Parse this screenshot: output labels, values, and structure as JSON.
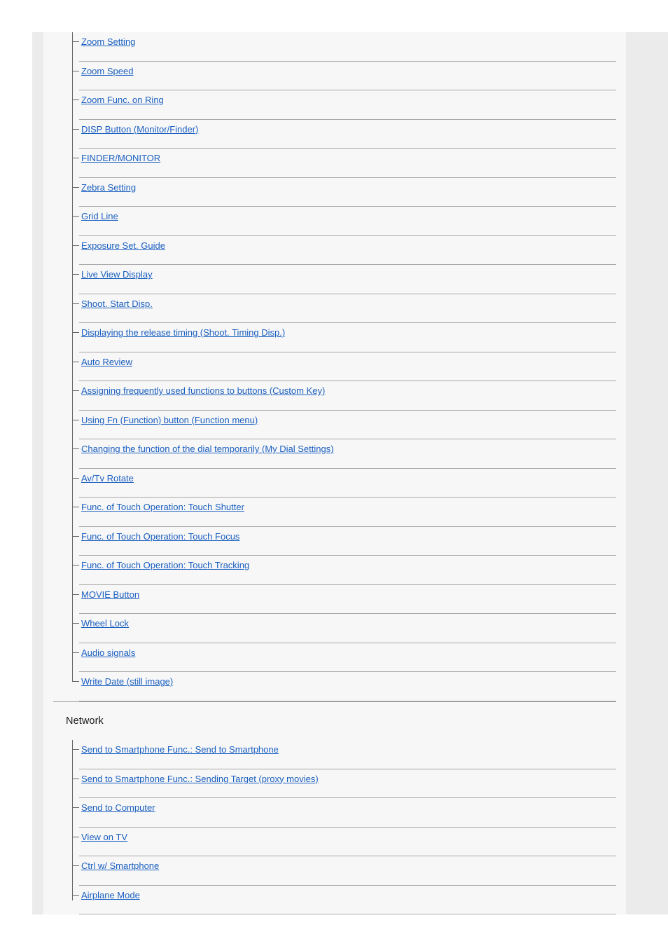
{
  "theme": {
    "page_background": "#ffffff",
    "gutter_background": "#ebebeb",
    "content_background": "#f7f7f7",
    "link_color": "#1a5fc0",
    "heading_color": "#1a1a1a",
    "tree_line_color": "#666666",
    "row_separator_color": "#a8a8a8",
    "section_divider_color": "#999999"
  },
  "sections": [
    {
      "title": null,
      "items": [
        {
          "label": "Zoom Setting"
        },
        {
          "label": "Zoom Speed"
        },
        {
          "label": "Zoom Func. on Ring"
        },
        {
          "label": "DISP Button (Monitor/Finder)"
        },
        {
          "label": "FINDER/MONITOR"
        },
        {
          "label": "Zebra Setting"
        },
        {
          "label": "Grid Line"
        },
        {
          "label": "Exposure Set. Guide"
        },
        {
          "label": "Live View Display"
        },
        {
          "label": "Shoot. Start Disp."
        },
        {
          "label": "Displaying the release timing (Shoot. Timing Disp.)"
        },
        {
          "label": "Auto Review"
        },
        {
          "label": "Assigning frequently used functions to buttons (Custom Key)"
        },
        {
          "label": "Using Fn (Function) button (Function menu)"
        },
        {
          "label": "Changing the function of the dial temporarily (My Dial Settings)"
        },
        {
          "label": "Av/Tv Rotate"
        },
        {
          "label": "Func. of Touch Operation: Touch Shutter"
        },
        {
          "label": "Func. of Touch Operation: Touch Focus"
        },
        {
          "label": "Func. of Touch Operation: Touch Tracking"
        },
        {
          "label": "MOVIE Button"
        },
        {
          "label": "Wheel Lock"
        },
        {
          "label": "Audio signals"
        },
        {
          "label": "Write Date (still image)"
        }
      ]
    },
    {
      "title": "Network",
      "items": [
        {
          "label": "Send to Smartphone Func.: Send to Smartphone"
        },
        {
          "label": "Send to Smartphone Func.: Sending Target (proxy movies)"
        },
        {
          "label": "Send to Computer"
        },
        {
          "label": "View on TV"
        },
        {
          "label": "Ctrl w/ Smartphone"
        },
        {
          "label": "Airplane Mode"
        }
      ]
    }
  ]
}
